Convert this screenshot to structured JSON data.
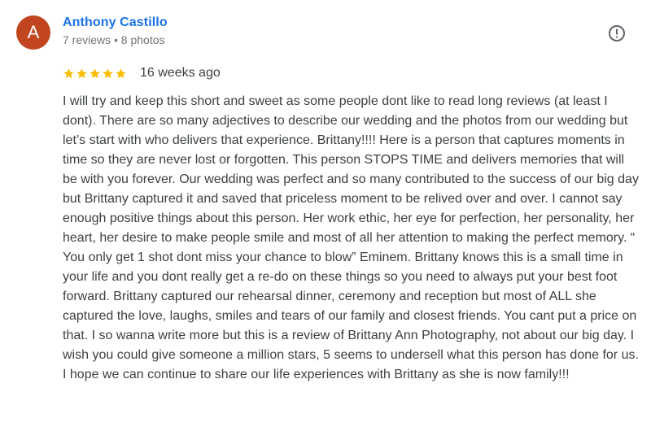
{
  "reviewer": {
    "initial": "A",
    "name": "Anthony Castillo",
    "stats": "7 reviews • 8 photos",
    "avatar_color": "#c1461f"
  },
  "review": {
    "rating": 5,
    "max_rating": 5,
    "date": "16 weeks ago",
    "text": "I will try and keep this short and sweet as some people dont like to read long reviews (at least I dont). There are so many adjectives to describe our wedding and the photos from our wedding but let’s start with who delivers that experience. Brittany!!!! Here is a person that captures moments in time so they are never lost or forgotten. This person STOPS TIME and delivers memories that will be with you forever. Our wedding was perfect and so many contributed to the success of our big day but Brittany captured it and saved that priceless moment to be relived over and over. I cannot say enough positive things about this person. Her work ethic, her eye for perfection, her personality, her heart, her desire to make people smile and most of all her attention to making the perfect memory. “ You only get 1 shot dont miss your chance to blow” Eminem. Brittany knows this is a small time in your life and you dont really get a re-do on these things so you need to always put your best foot forward. Brittany captured our rehearsal dinner, ceremony and reception but most of ALL she captured the love, laughs, smiles and tears of our family and closest friends. You cant put a price on that. I so wanna write more but this is a review of Brittany Ann Photography, not about our big day. I wish you could give someone a million stars, 5 seems to undersell what this person has done for us. I hope we can continue to share our life experiences with Brittany as she is now family!!!"
  },
  "icons": {
    "report": "flag-report-icon",
    "star": "star-icon"
  },
  "colors": {
    "star": "#fbbc04",
    "name_link": "#1a73e8",
    "secondary_text": "#70757a",
    "body_text": "#3c4043",
    "report_icon": "#5f6368"
  }
}
